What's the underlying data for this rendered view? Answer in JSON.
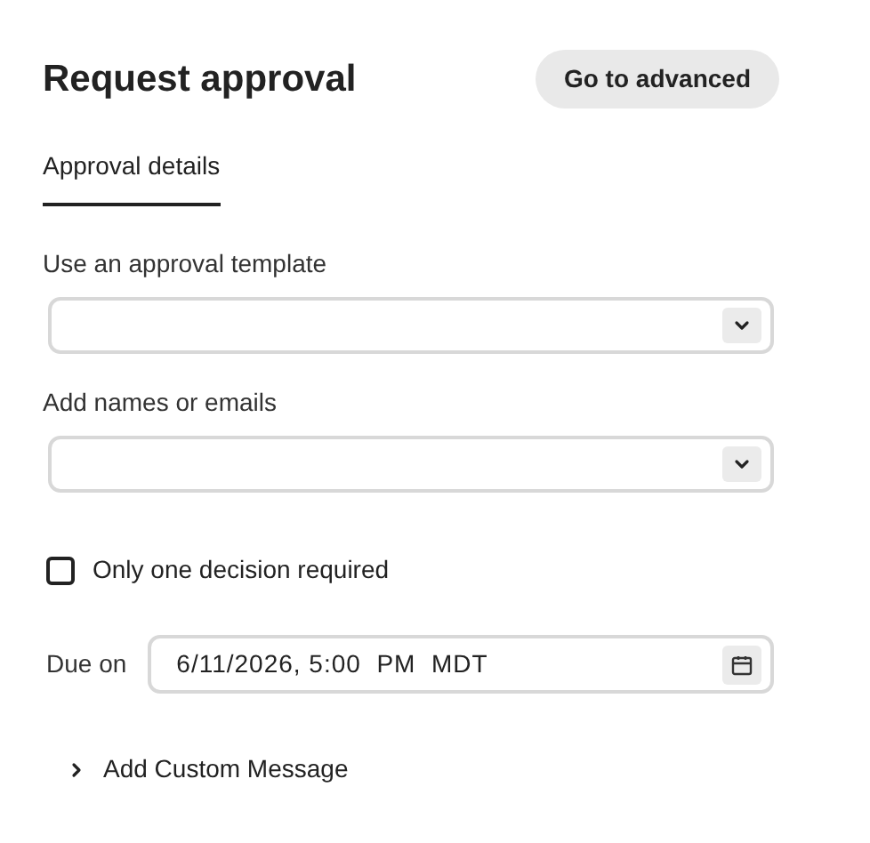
{
  "title": "Request approval",
  "advanced_button": "Go to advanced",
  "tabs": [
    {
      "label": "Approval details",
      "selected": true
    }
  ],
  "fields": [
    {
      "label": "Use an approval template"
    },
    {
      "label": "Add names or emails"
    }
  ],
  "single_decision": {
    "label": "Only one decision required",
    "checked": false
  },
  "due": {
    "label": "Due on",
    "value": "6/11/2026, 5:00  PM  MDT"
  },
  "custom_message": {
    "label": "Add Custom Message",
    "expanded": false
  }
}
